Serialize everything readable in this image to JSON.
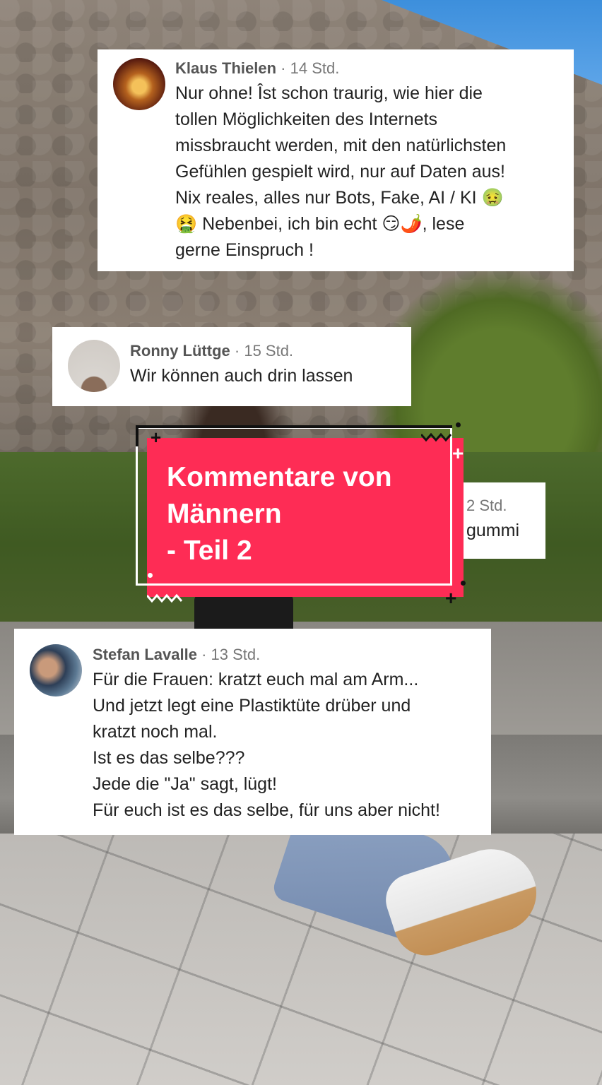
{
  "comments": [
    {
      "author": "Klaus Thielen",
      "time": "· 14 Std.",
      "lines": [
        "Nur ohne! Îst schon traurig, wie hier die",
        "tollen Möglichkeiten des Internets",
        "missbraucht werden, mit den natürlichsten",
        "Gefühlen gespielt wird, nur auf Daten aus!",
        "Nix reales, alles nur Bots, Fake, AI / KI  🤢",
        "🤮 Nebenbei, ich bin echt 😏🌶️, lese",
        "gerne Einspruch !"
      ]
    },
    {
      "author": "Ronny Lüttge",
      "time": "· 15 Std.",
      "lines": [
        "Wir können auch drin lassen"
      ]
    },
    {
      "author": "",
      "time": "2 Std.",
      "lines": [
        "gummi"
      ]
    },
    {
      "author": "Stefan Lavalle",
      "time": "· 13 Std.",
      "lines": [
        "Für die Frauen: kratzt euch mal am Arm...",
        "Und jetzt legt eine Plastiktüte drüber und",
        "kratzt noch mal.",
        "Ist es das selbe???",
        "Jede die \"Ja\" sagt, lügt!",
        "Für euch ist es das selbe, für uns aber nicht!"
      ]
    }
  ],
  "title_overlay": {
    "lines": [
      "Kommentare von",
      "Männern",
      "- Teil 2"
    ],
    "accent_color": "#fe2c55"
  },
  "icons": [
    "plus-decoration-icon",
    "zigzag-decoration-icon",
    "dot-decoration-icon"
  ]
}
